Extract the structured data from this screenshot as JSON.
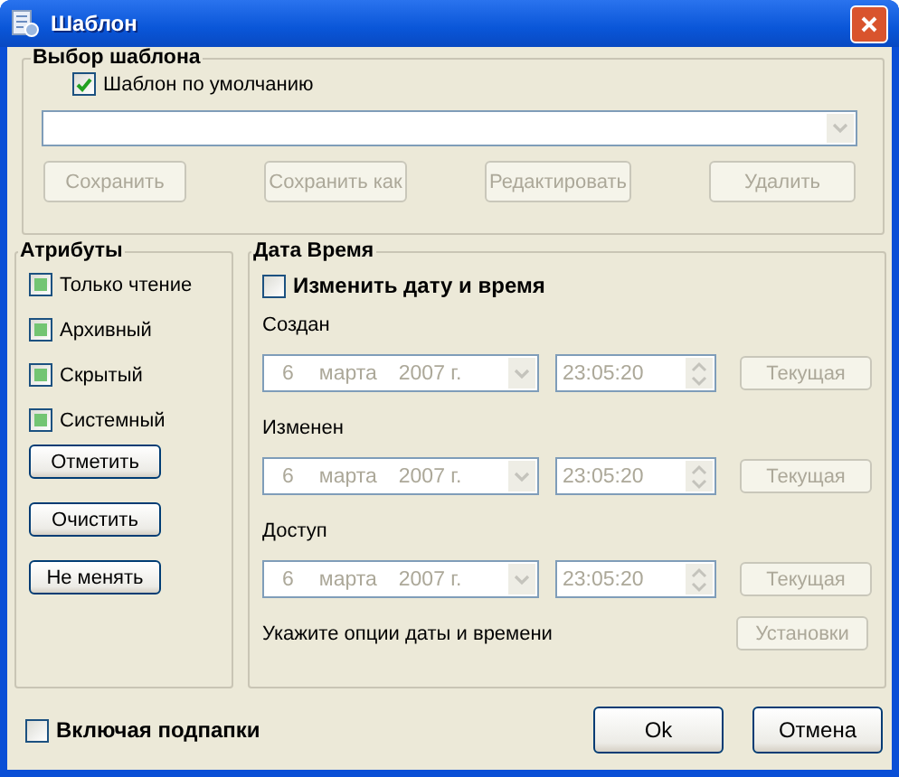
{
  "window": {
    "title": "Шаблон"
  },
  "template_group": {
    "title": "Выбор шаблона",
    "default_checkbox": {
      "label": "Шаблон по умолчанию",
      "checked": true
    },
    "buttons": [
      {
        "label": "Сохранить",
        "disabled": true
      },
      {
        "label": "Сохранить как",
        "disabled": true
      },
      {
        "label": "Редактировать",
        "disabled": true
      },
      {
        "label": "Удалить",
        "disabled": true
      }
    ]
  },
  "attributes_group": {
    "title": "Атрибуты",
    "items": [
      {
        "label": "Только чтение",
        "indeterminate": true
      },
      {
        "label": "Архивный",
        "indeterminate": true
      },
      {
        "label": "Скрытый",
        "indeterminate": true
      },
      {
        "label": "Системный",
        "indeterminate": true
      }
    ],
    "buttons": [
      {
        "label": "Отметить",
        "disabled": false
      },
      {
        "label": "Очистить",
        "disabled": false
      },
      {
        "label": "Не менять",
        "disabled": false
      }
    ]
  },
  "datetime_group": {
    "title": "Дата Время",
    "change_checkbox": {
      "label": "Изменить дату и время",
      "checked": false
    },
    "rows": [
      {
        "label": "Создан",
        "day": "6",
        "month": "марта",
        "year": "2007 г.",
        "time": "23:05:20",
        "button": "Текущая",
        "disabled": true
      },
      {
        "label": "Изменен",
        "day": "6",
        "month": "марта",
        "year": "2007 г.",
        "time": "23:05:20",
        "button": "Текущая",
        "disabled": true
      },
      {
        "label": "Доступ",
        "day": "6",
        "month": "марта",
        "year": "2007 г.",
        "time": "23:05:20",
        "button": "Текущая",
        "disabled": true
      }
    ],
    "hint": "Укажите опции даты и времени",
    "settings_button": {
      "label": "Установки",
      "disabled": true
    }
  },
  "include_subfolders": {
    "label": "Включая подпапки",
    "checked": false
  },
  "footer_buttons": [
    {
      "label": "Ok",
      "disabled": false
    },
    {
      "label": "Отмена",
      "disabled": false
    }
  ]
}
